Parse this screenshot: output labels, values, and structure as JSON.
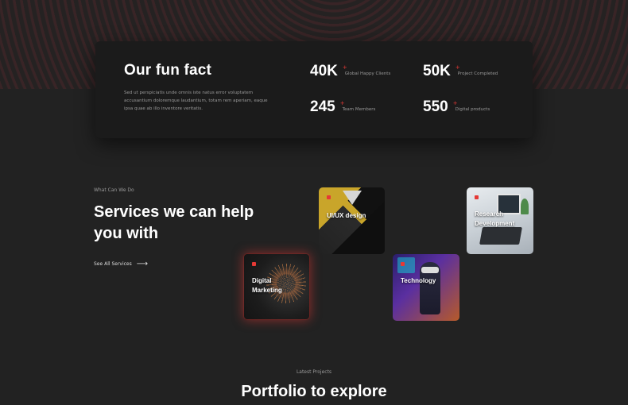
{
  "fun_fact": {
    "title": "Our fun fact",
    "description": "Sed ut perspiciatis unde omnis iste natus error voluptatem accusantium doloremque laudantium, totam rem aperiam, eaque ipsa quae ab illo inventore veritatis.",
    "stats": [
      {
        "value": "40K",
        "plus": "+",
        "label": "Global Happy Clients"
      },
      {
        "value": "50K",
        "plus": "+",
        "label": "Project Completed"
      },
      {
        "value": "245",
        "plus": "+",
        "label": "Team Members"
      },
      {
        "value": "550",
        "plus": "+",
        "label": "Digital products"
      }
    ]
  },
  "services": {
    "kicker": "What Can We Do",
    "title": "Services we can help you with",
    "see_all": "See All Services",
    "cards": [
      {
        "label": "UI/UX design"
      },
      {
        "label": "Research Development"
      },
      {
        "label": "Digital Marketing"
      },
      {
        "label": "Technology"
      }
    ]
  },
  "portfolio": {
    "kicker": "Latest Projects",
    "title": "Portfolio to explore"
  },
  "colors": {
    "accent": "#e53935",
    "background": "#222222",
    "card": "#1b1b1b"
  },
  "icons": {
    "see_all_arrow": "arrow-right-icon"
  }
}
